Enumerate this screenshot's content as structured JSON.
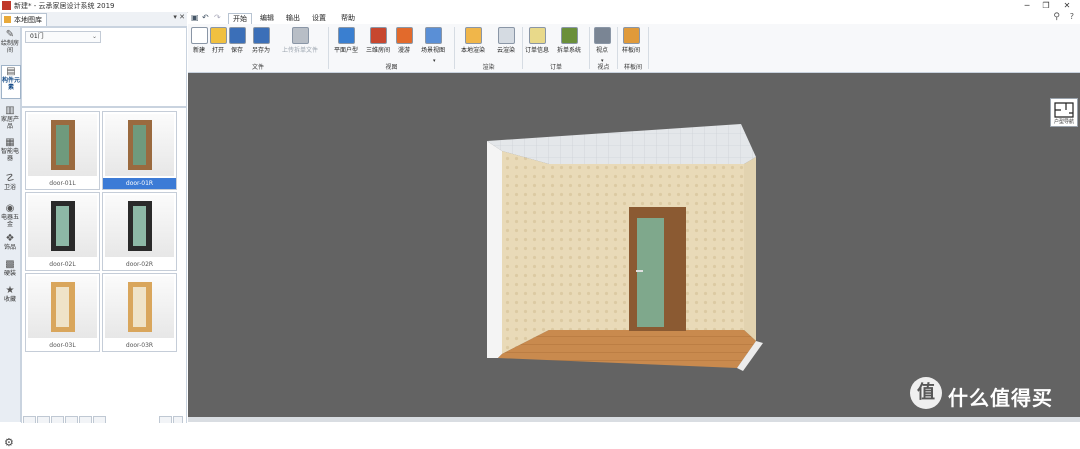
{
  "window": {
    "title": "新建* - 云承家居设计系统 2019",
    "minimize": "─",
    "restore": "❐",
    "close": "✕"
  },
  "left_panel": {
    "tab_label": "本地图库",
    "pin": "▾ ✕",
    "filter_value": "01门",
    "categories": [
      {
        "label": "绘制房间",
        "glyph": "✎"
      },
      {
        "label": "构件元素",
        "glyph": "▤"
      },
      {
        "label": "家居产品",
        "glyph": "▥"
      },
      {
        "label": "智能电器",
        "glyph": "▦"
      },
      {
        "label": "卫浴",
        "glyph": "☡"
      },
      {
        "label": "电器五金",
        "glyph": "◉"
      },
      {
        "label": "饰品",
        "glyph": "❖"
      },
      {
        "label": "硬装",
        "glyph": "▩"
      },
      {
        "label": "收藏",
        "glyph": "★"
      }
    ],
    "items": [
      {
        "caption": "door-01L",
        "frame": "#9a6a3f",
        "pane": "#6f9a7d"
      },
      {
        "caption": "door-01R",
        "frame": "#9a6a3f",
        "pane": "#6f9a7d"
      },
      {
        "caption": "door-02L",
        "frame": "#2a2a2a",
        "pane": "#8db8a6"
      },
      {
        "caption": "door-02R",
        "frame": "#2a2a2a",
        "pane": "#8db8a6"
      },
      {
        "caption": "door-03L",
        "frame": "#d9a65c",
        "pane": "#efe3c8"
      },
      {
        "caption": "door-03R",
        "frame": "#d9a65c",
        "pane": "#efe3c8"
      }
    ],
    "selected_item": "door-01R"
  },
  "menu": {
    "items": [
      "开始",
      "编辑",
      "输出",
      "设置",
      "帮助"
    ],
    "active": "开始"
  },
  "ribbon": {
    "groups": [
      {
        "name": "文件",
        "buttons": [
          {
            "label": "新建",
            "icon": "new-file-icon",
            "color": "#ffffff"
          },
          {
            "label": "打开",
            "icon": "open-folder-icon",
            "color": "#f0c040"
          },
          {
            "label": "保存",
            "icon": "save-icon",
            "color": "#3b6fb8"
          },
          {
            "label": "另存为",
            "icon": "save-as-icon",
            "color": "#3b6fb8"
          },
          {
            "label": "上传拆单文件",
            "icon": "upload-icon",
            "color": "#b8bec6",
            "disabled": true
          }
        ]
      },
      {
        "name": "视图",
        "buttons": [
          {
            "label": "平面户型",
            "icon": "floorplan-icon",
            "color": "#3a7fd0"
          },
          {
            "label": "三维房间",
            "icon": "3d-room-icon",
            "color": "#c7472f"
          },
          {
            "label": "漫游",
            "icon": "roam-icon",
            "color": "#e26a2c"
          },
          {
            "label": "场景视图",
            "icon": "scene-view-icon",
            "color": "#5a8fd6"
          }
        ]
      },
      {
        "name": "渲染",
        "buttons": [
          {
            "label": "本地渲染",
            "icon": "local-render-icon",
            "color": "#f0b64a"
          },
          {
            "label": "云渲染",
            "icon": "cloud-render-icon",
            "color": "#d5dbe2"
          }
        ]
      },
      {
        "name": "订单",
        "buttons": [
          {
            "label": "订单信息",
            "icon": "order-info-icon",
            "color": "#e8d98a"
          },
          {
            "label": "拆单系统",
            "icon": "split-order-icon",
            "color": "#6a8f3a"
          }
        ]
      },
      {
        "name": "视点",
        "buttons": [
          {
            "label": "视点",
            "icon": "viewpoint-icon",
            "color": "#7a8594"
          }
        ]
      },
      {
        "name": "样板间",
        "buttons": [
          {
            "label": "样板间",
            "icon": "sample-room-icon",
            "color": "#e09a3a"
          }
        ]
      }
    ]
  },
  "viewport": {
    "floorplan_badge": "户型导航",
    "watermark_badge": "值",
    "watermark_text": "什么值得买",
    "colors": {
      "background": "#636363",
      "wall": "#e9dab8",
      "ceiling": "#e4e7ea",
      "floor": "#c98a4e",
      "door_frame": "#8b5a32",
      "door_pane": "#7fa88c"
    }
  }
}
